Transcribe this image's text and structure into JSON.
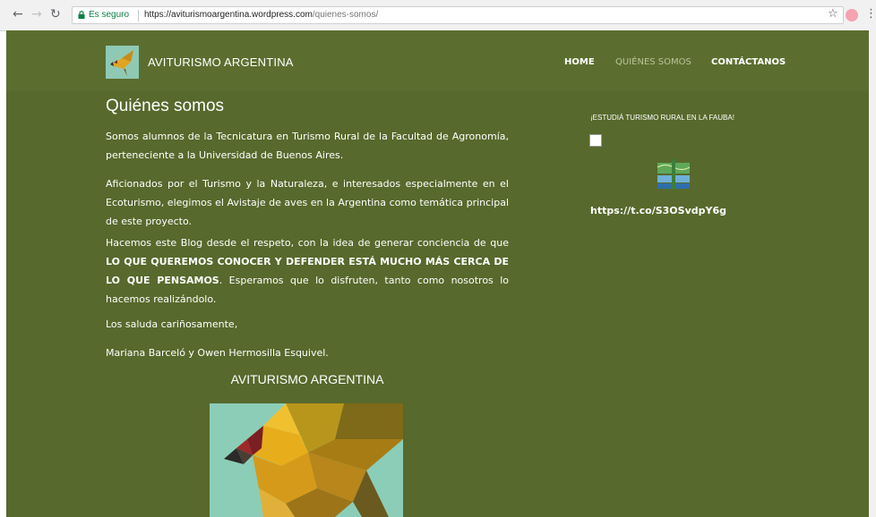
{
  "browser": {
    "secure_label": "Es seguro",
    "url_host": "https://aviturismoargentina.wordpress.com",
    "url_path": "/quienes-somos/"
  },
  "header": {
    "site_title": "AVITURISMO ARGENTINA",
    "nav": [
      "HOME",
      "QUIÉNES SOMOS",
      "CONTÁCTANOS"
    ]
  },
  "main": {
    "title": "Quiénes somos",
    "p1": "Somos alumnos de la Tecnicatura en Turismo Rural de la Facultad de Agronomía, perteneciente a la Universidad de Buenos Aires.",
    "p2": "Aficionados por el Turismo y la Naturaleza, e interesados especialmente en el Ecoturismo, elegimos el Avistaje de aves en la Argentina como temática principal de este proyecto.",
    "p3_a": "Hacemos este Blog desde el respeto, con la idea de generar conciencia de que ",
    "p3_bold": "LO QUE QUEREMOS CONOCER Y DEFENDER ESTÁ MUCHO MÁS CERCA DE LO QUE PENSAMOS",
    "p3_b": ". Esperamos que lo disfruten, tanto como nosotros lo hacemos realizándolo.",
    "p4": "Los saluda cariñosamente,",
    "p5": "Mariana Barceló y Owen Hermosilla Esquivel.",
    "subtitle": "AVITURISMO ARGENTINA"
  },
  "sidebar": {
    "widget_title": "¡ESTUDIÁ TURISMO RURAL EN LA FAUBA!",
    "link": "https://t.co/S3OSvdpY6g"
  },
  "colors": {
    "page_bg": "#57692c",
    "header_bg": "#5b6e2f",
    "nav_active": "#b9c49a"
  }
}
